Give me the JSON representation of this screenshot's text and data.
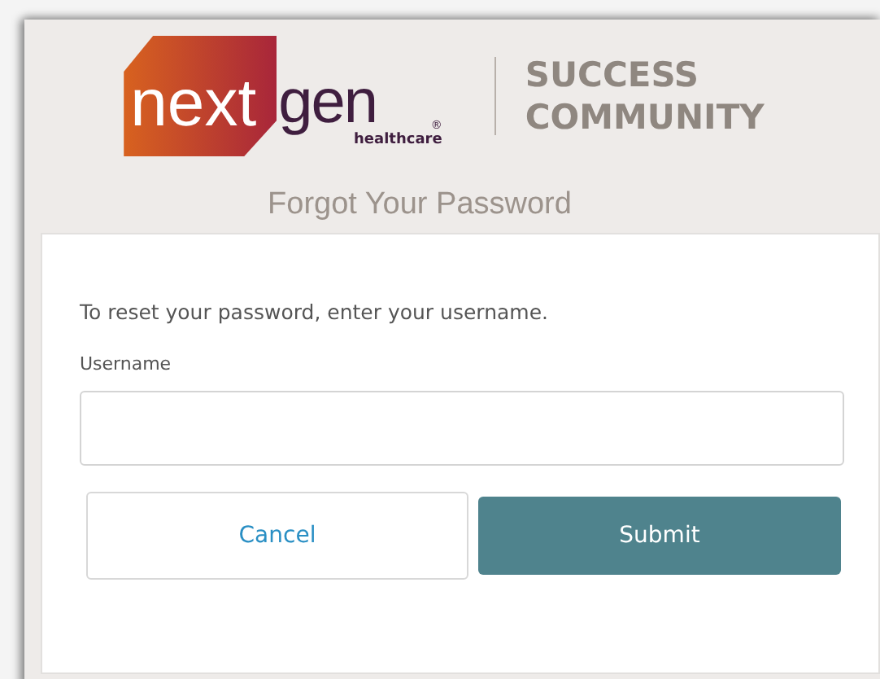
{
  "logo": {
    "word_1": "next",
    "word_2": "gen",
    "registered": "®",
    "tagline": "healthcare"
  },
  "community": [
    "SUCCESS",
    "COMMUNITY"
  ],
  "title": "Forgot Your Password",
  "form": {
    "instruction": "To reset your password, enter your username.",
    "field_label": "Username",
    "buttons": [
      {
        "label": "Cancel",
        "kind": "secondary"
      },
      {
        "label": "Submit",
        "kind": "primary"
      }
    ]
  }
}
